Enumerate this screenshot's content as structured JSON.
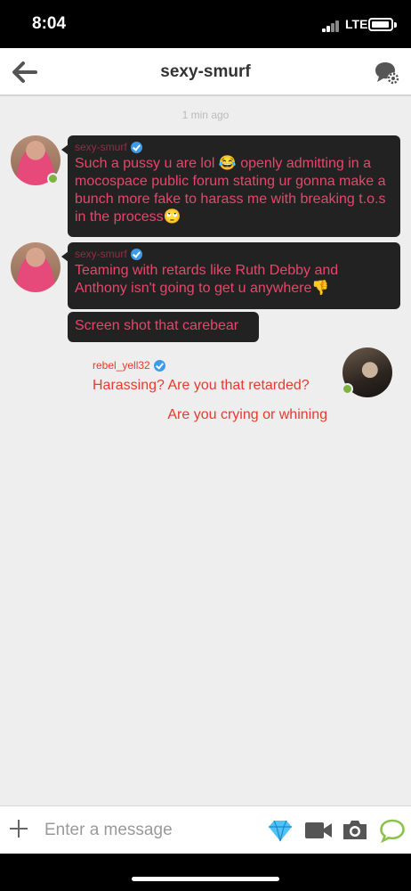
{
  "status_bar": {
    "time": "8:04",
    "network": "LTE"
  },
  "header": {
    "title": "sexy-smurf",
    "back_icon": "arrow-left-icon",
    "settings_icon": "chat-settings-icon"
  },
  "chat": {
    "timestamp": "1 min ago",
    "messages": [
      {
        "sender": "sexy-smurf",
        "text": "Such a pussy u are lol 😂 openly admitting in a mocospace public forum stating ur gonna make a bunch more fake to harass me with breaking t.o.s in the process🙄"
      },
      {
        "sender": "sexy-smurf",
        "text": "Teaming with retards like Ruth Debby and Anthony isn't going to get u anywhere👎"
      },
      {
        "text": "Screen shot that carebear"
      },
      {
        "sender": "rebel_yell32",
        "text": "Harassing? Are you that retarded?"
      },
      {
        "text": "Are you crying or whining"
      }
    ]
  },
  "input": {
    "placeholder": "Enter a message"
  },
  "colors": {
    "incoming_text": "#e8456b",
    "outgoing_text": "#e8392f",
    "bubble_bg": "#222222",
    "online": "#7cb342",
    "verified": "#3b9be8",
    "accent_green": "#8bc34a"
  }
}
